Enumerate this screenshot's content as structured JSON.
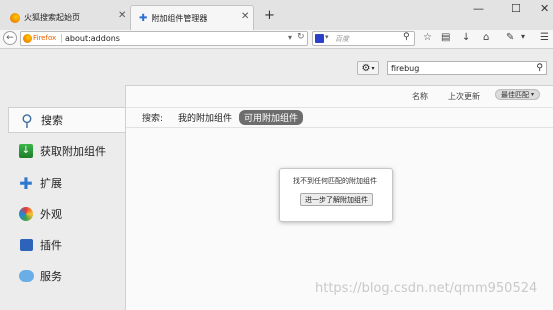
{
  "tabs": [
    {
      "title": "火狐搜索起始页"
    },
    {
      "title": "附加组件管理器"
    }
  ],
  "new_tab_symbol": "+",
  "navbar": {
    "identity_label": "Firefox",
    "url": "about:addons",
    "search_placeholder": "百度"
  },
  "addons_search": {
    "value": "firebug"
  },
  "sort_row": {
    "name": "名称",
    "last_updated": "上次更新",
    "best_match": "最佳匹配"
  },
  "filter_row": {
    "label": "搜索:",
    "my_addons": "我的附加组件",
    "available_addons": "可用附加组件"
  },
  "sidebar": {
    "items": [
      {
        "label": "搜索",
        "icon": "magnifier-icon"
      },
      {
        "label": "获取附加组件",
        "icon": "download-icon"
      },
      {
        "label": "扩展",
        "icon": "puzzle-icon"
      },
      {
        "label": "外观",
        "icon": "paintbrush-icon"
      },
      {
        "label": "插件",
        "icon": "plugin-brick-icon"
      },
      {
        "label": "服务",
        "icon": "speech-bubble-icon"
      }
    ]
  },
  "empty_notice": {
    "message": "找不到任何匹配的附加组件",
    "button": "进一步了解附加组件"
  },
  "watermark": "https://blog.csdn.net/qmm950524",
  "colors": {
    "selected_filter": "#6d6d6d",
    "firefox_orange": "#e66000"
  }
}
